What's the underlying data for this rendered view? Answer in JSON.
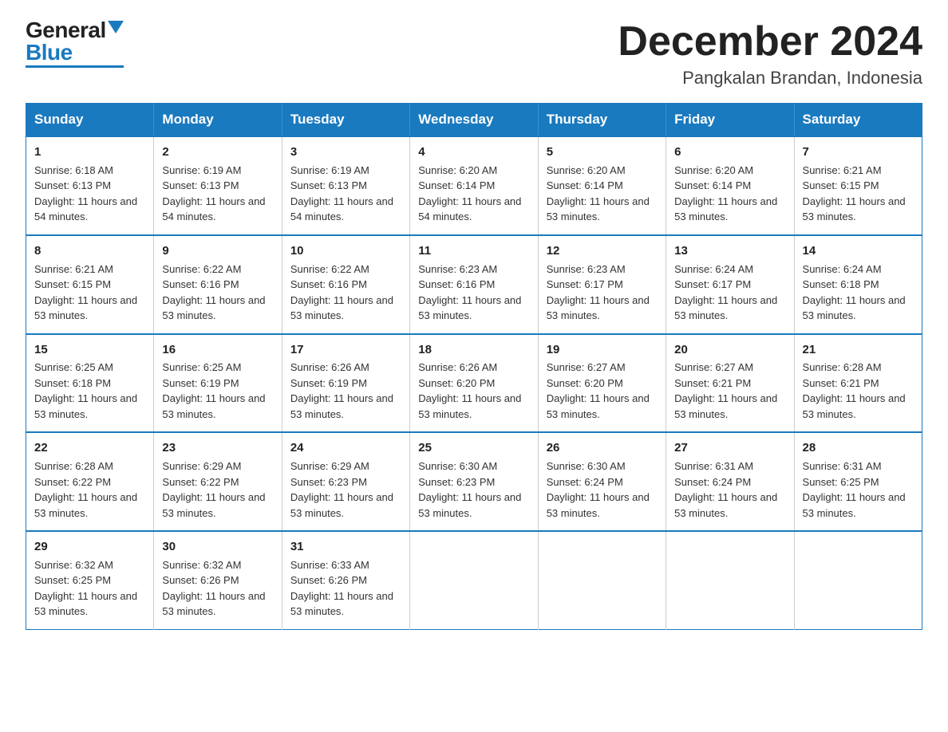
{
  "header": {
    "title": "December 2024",
    "subtitle": "Pangkalan Brandan, Indonesia"
  },
  "logo": {
    "general": "General",
    "blue": "Blue"
  },
  "days": [
    "Sunday",
    "Monday",
    "Tuesday",
    "Wednesday",
    "Thursday",
    "Friday",
    "Saturday"
  ],
  "weeks": [
    [
      {
        "num": "1",
        "sunrise": "6:18 AM",
        "sunset": "6:13 PM",
        "daylight": "11 hours and 54 minutes."
      },
      {
        "num": "2",
        "sunrise": "6:19 AM",
        "sunset": "6:13 PM",
        "daylight": "11 hours and 54 minutes."
      },
      {
        "num": "3",
        "sunrise": "6:19 AM",
        "sunset": "6:13 PM",
        "daylight": "11 hours and 54 minutes."
      },
      {
        "num": "4",
        "sunrise": "6:20 AM",
        "sunset": "6:14 PM",
        "daylight": "11 hours and 54 minutes."
      },
      {
        "num": "5",
        "sunrise": "6:20 AM",
        "sunset": "6:14 PM",
        "daylight": "11 hours and 53 minutes."
      },
      {
        "num": "6",
        "sunrise": "6:20 AM",
        "sunset": "6:14 PM",
        "daylight": "11 hours and 53 minutes."
      },
      {
        "num": "7",
        "sunrise": "6:21 AM",
        "sunset": "6:15 PM",
        "daylight": "11 hours and 53 minutes."
      }
    ],
    [
      {
        "num": "8",
        "sunrise": "6:21 AM",
        "sunset": "6:15 PM",
        "daylight": "11 hours and 53 minutes."
      },
      {
        "num": "9",
        "sunrise": "6:22 AM",
        "sunset": "6:16 PM",
        "daylight": "11 hours and 53 minutes."
      },
      {
        "num": "10",
        "sunrise": "6:22 AM",
        "sunset": "6:16 PM",
        "daylight": "11 hours and 53 minutes."
      },
      {
        "num": "11",
        "sunrise": "6:23 AM",
        "sunset": "6:16 PM",
        "daylight": "11 hours and 53 minutes."
      },
      {
        "num": "12",
        "sunrise": "6:23 AM",
        "sunset": "6:17 PM",
        "daylight": "11 hours and 53 minutes."
      },
      {
        "num": "13",
        "sunrise": "6:24 AM",
        "sunset": "6:17 PM",
        "daylight": "11 hours and 53 minutes."
      },
      {
        "num": "14",
        "sunrise": "6:24 AM",
        "sunset": "6:18 PM",
        "daylight": "11 hours and 53 minutes."
      }
    ],
    [
      {
        "num": "15",
        "sunrise": "6:25 AM",
        "sunset": "6:18 PM",
        "daylight": "11 hours and 53 minutes."
      },
      {
        "num": "16",
        "sunrise": "6:25 AM",
        "sunset": "6:19 PM",
        "daylight": "11 hours and 53 minutes."
      },
      {
        "num": "17",
        "sunrise": "6:26 AM",
        "sunset": "6:19 PM",
        "daylight": "11 hours and 53 minutes."
      },
      {
        "num": "18",
        "sunrise": "6:26 AM",
        "sunset": "6:20 PM",
        "daylight": "11 hours and 53 minutes."
      },
      {
        "num": "19",
        "sunrise": "6:27 AM",
        "sunset": "6:20 PM",
        "daylight": "11 hours and 53 minutes."
      },
      {
        "num": "20",
        "sunrise": "6:27 AM",
        "sunset": "6:21 PM",
        "daylight": "11 hours and 53 minutes."
      },
      {
        "num": "21",
        "sunrise": "6:28 AM",
        "sunset": "6:21 PM",
        "daylight": "11 hours and 53 minutes."
      }
    ],
    [
      {
        "num": "22",
        "sunrise": "6:28 AM",
        "sunset": "6:22 PM",
        "daylight": "11 hours and 53 minutes."
      },
      {
        "num": "23",
        "sunrise": "6:29 AM",
        "sunset": "6:22 PM",
        "daylight": "11 hours and 53 minutes."
      },
      {
        "num": "24",
        "sunrise": "6:29 AM",
        "sunset": "6:23 PM",
        "daylight": "11 hours and 53 minutes."
      },
      {
        "num": "25",
        "sunrise": "6:30 AM",
        "sunset": "6:23 PM",
        "daylight": "11 hours and 53 minutes."
      },
      {
        "num": "26",
        "sunrise": "6:30 AM",
        "sunset": "6:24 PM",
        "daylight": "11 hours and 53 minutes."
      },
      {
        "num": "27",
        "sunrise": "6:31 AM",
        "sunset": "6:24 PM",
        "daylight": "11 hours and 53 minutes."
      },
      {
        "num": "28",
        "sunrise": "6:31 AM",
        "sunset": "6:25 PM",
        "daylight": "11 hours and 53 minutes."
      }
    ],
    [
      {
        "num": "29",
        "sunrise": "6:32 AM",
        "sunset": "6:25 PM",
        "daylight": "11 hours and 53 minutes."
      },
      {
        "num": "30",
        "sunrise": "6:32 AM",
        "sunset": "6:26 PM",
        "daylight": "11 hours and 53 minutes."
      },
      {
        "num": "31",
        "sunrise": "6:33 AM",
        "sunset": "6:26 PM",
        "daylight": "11 hours and 53 minutes."
      },
      null,
      null,
      null,
      null
    ]
  ]
}
